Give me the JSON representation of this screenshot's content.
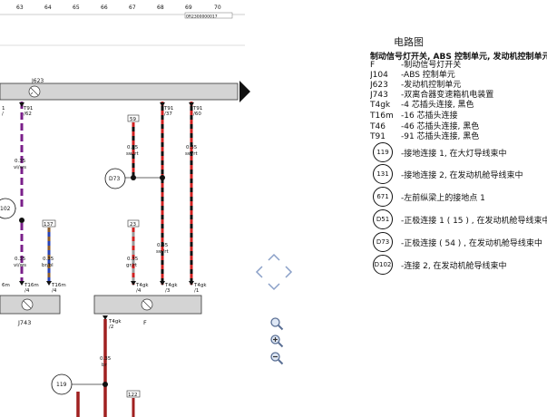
{
  "ruler": [
    "63",
    "64",
    "65",
    "66",
    "67",
    "68",
    "69",
    "70"
  ],
  "ruler_box_text": "0R2300000017",
  "components": {
    "j623": {
      "label": "J623"
    },
    "j743": {
      "label": "J743"
    },
    "f": {
      "label": "F"
    }
  },
  "wires": [
    {
      "id": "w1",
      "pin": "T91",
      "pin2": "/62",
      "gauge": "0.35",
      "color": "vi/ws"
    },
    {
      "id": "w2",
      "pin": "T91",
      "pin2": "/37",
      "gauge": "0.35",
      "color": "sw/rt"
    },
    {
      "id": "w3",
      "pin": "T91",
      "pin2": "/60",
      "gauge": "0.35",
      "color": "sw/rt"
    },
    {
      "id": "w4",
      "gauge": "0.35",
      "color": "vi/ws"
    },
    {
      "id": "w5",
      "gauge": "0.35",
      "color": "br/bl"
    },
    {
      "id": "w6",
      "gauge": "0.35",
      "color": "gr/rt"
    },
    {
      "id": "w7",
      "gauge": "0.35",
      "color": "sw/rt"
    },
    {
      "id": "w8",
      "gauge": "0.35",
      "color": "br"
    }
  ],
  "ref_boxes": {
    "b59": "59",
    "b137": "137",
    "b23": "23",
    "b122": "122"
  },
  "ground_refs": {
    "d73": "D73",
    "r102": "102",
    "r119": "119"
  },
  "connectors": {
    "j743_left": "T16m",
    "j743_pin1": "/4",
    "j743_pin2": "T16m",
    "j743_pin2b": "/4",
    "f_pin1": "T4gk",
    "f_pin1b": "/4",
    "f_pin2": "T4gk",
    "f_pin2b": "/3",
    "f_pin3": "T4gk",
    "f_pin3b": "/1",
    "f_bottom": "T4gk",
    "f_bottomb": "/2",
    "left_edge_6m": "6m",
    "left_edge_1": "1"
  },
  "legend": {
    "header": "电路图",
    "title": "制动信号灯开关, ABS 控制单元, 发动机控制单元",
    "codes": [
      {
        "code": "F",
        "desc": "-制动信号灯开关"
      },
      {
        "code": "J104",
        "desc": "-ABS 控制单元"
      },
      {
        "code": "J623",
        "desc": "-发动机控制单元"
      },
      {
        "code": "J743",
        "desc": "-双离合器变速箱机电装置"
      },
      {
        "code": "T4gk",
        "desc": "-4 芯插头连接, 黑色"
      },
      {
        "code": "T16m",
        "desc": "-16 芯插头连接"
      },
      {
        "code": "T46",
        "desc": "-46 芯插头连接, 黑色"
      },
      {
        "code": "T91",
        "desc": "-91 芯插头连接, 黑色"
      }
    ],
    "circles": [
      {
        "code": "119",
        "desc": "-接地连接 1, 在大灯导线束中"
      },
      {
        "code": "131",
        "desc": "-接地连接 2, 在发动机舱导线束中"
      },
      {
        "code": "671",
        "desc": "-左前纵梁上的接地点 1"
      },
      {
        "code": "D51",
        "desc": "-正极连接 1 ( 15 ) , 在发动机舱导线束中"
      },
      {
        "code": "D73",
        "desc": "-正极连接 ( 54 ) , 在发动机舱导线束中"
      },
      {
        "code": "D102",
        "desc": "-连接 2, 在发动机舱导线束中"
      }
    ]
  },
  "icons": {
    "pan": "pan-arrows-icon",
    "zoom_in": "zoom-in-icon",
    "zoom_plus": "zoom-plus-icon",
    "zoom_out": "zoom-out-icon"
  }
}
